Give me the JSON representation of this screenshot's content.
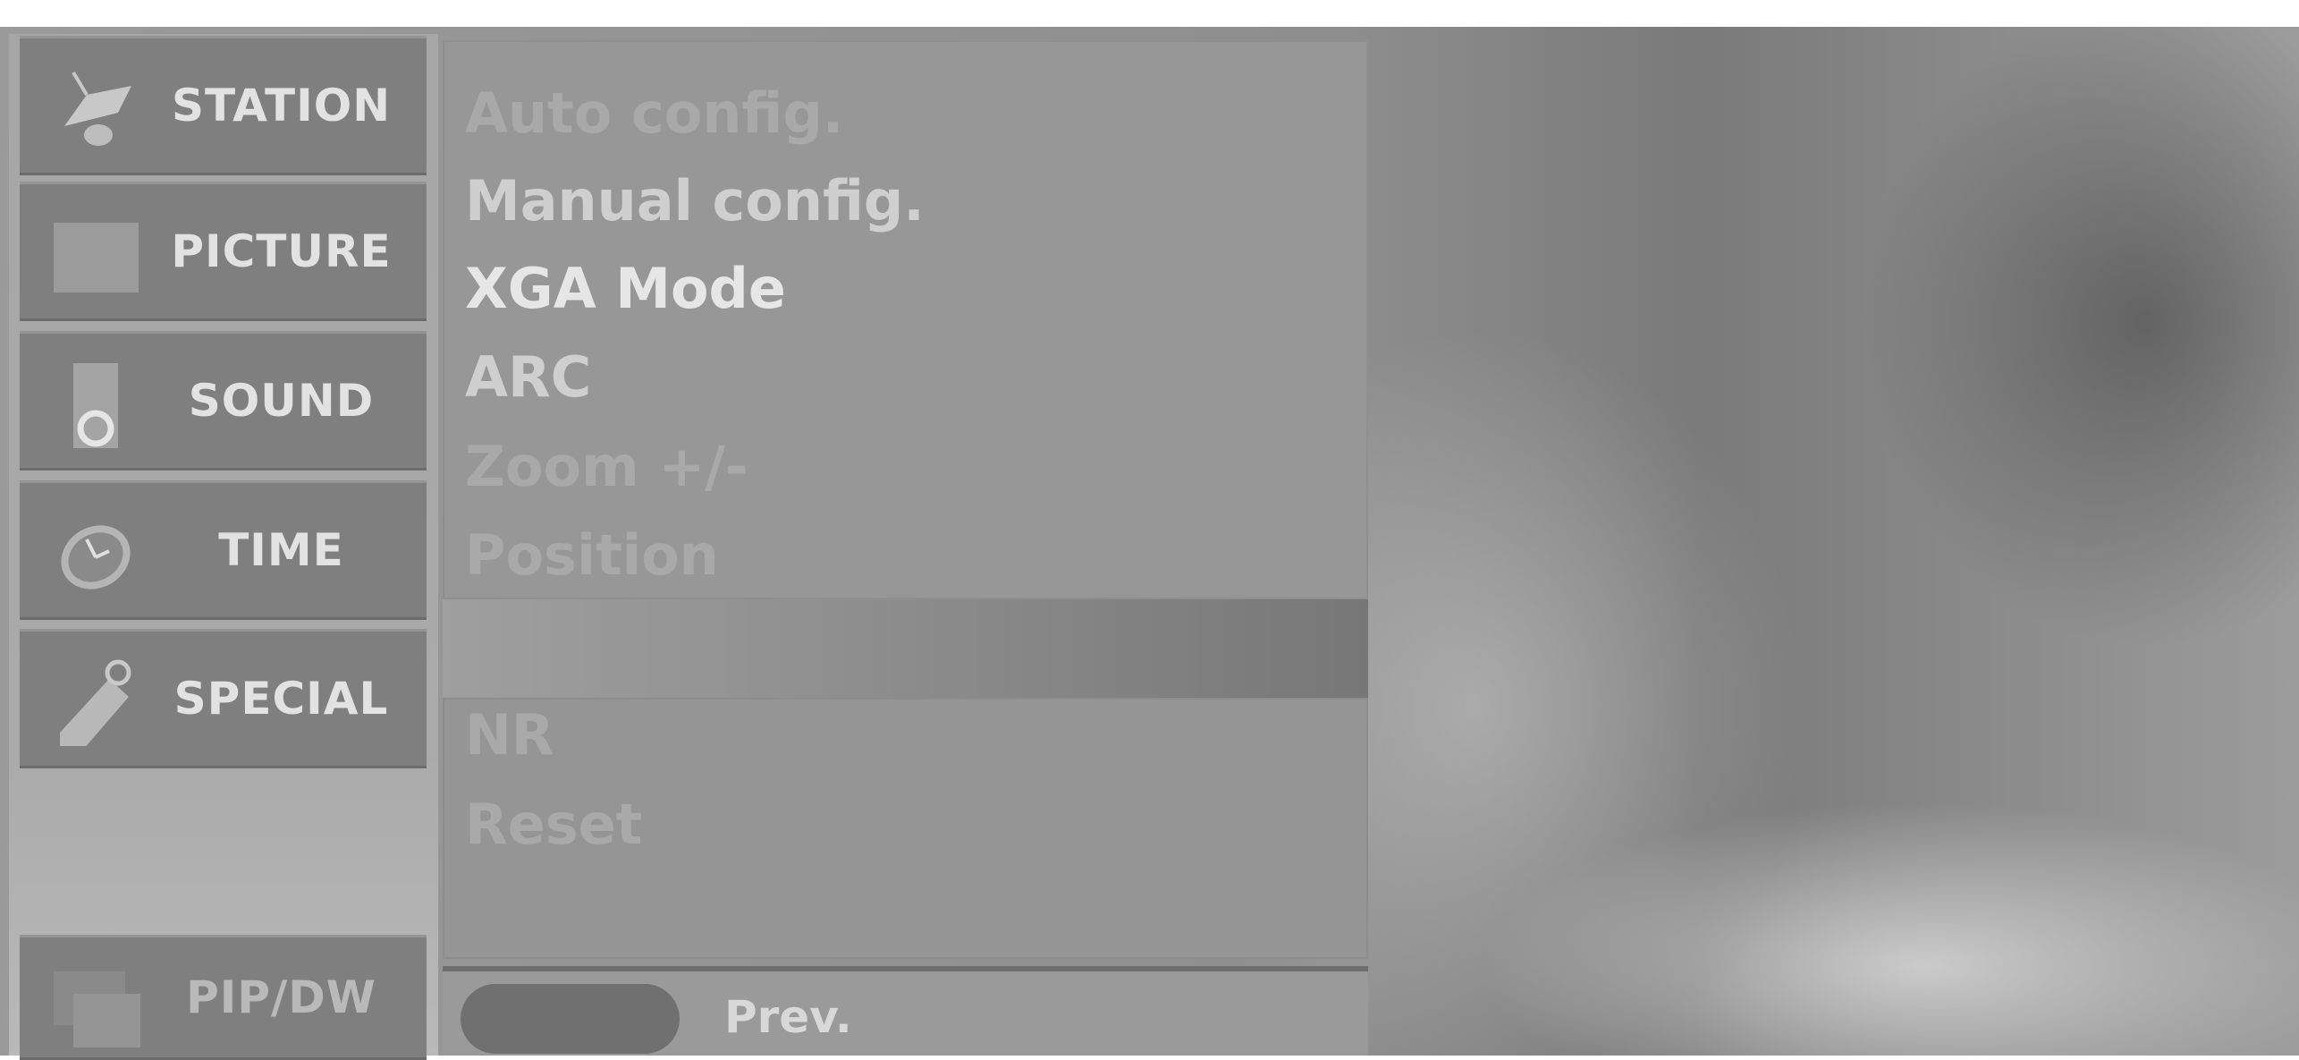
{
  "sidebar": {
    "items": [
      {
        "label": "STATION",
        "icon": "satellite-dish-icon"
      },
      {
        "label": "PICTURE",
        "icon": "picture-square-icon"
      },
      {
        "label": "SOUND",
        "icon": "speaker-icon"
      },
      {
        "label": "TIME",
        "icon": "clock-icon"
      },
      {
        "label": "SPECIAL",
        "icon": "tag-icon"
      }
    ],
    "bottom_item": {
      "label": "PIP/DW",
      "icon": "pip-window-icon"
    }
  },
  "menu": {
    "items": [
      {
        "label": "Auto config."
      },
      {
        "label": "Manual config."
      },
      {
        "label": "XGA Mode",
        "selected": true
      },
      {
        "label": "ARC"
      },
      {
        "label": "Zoom +/-"
      },
      {
        "label": "Position"
      }
    ],
    "lower_items": [
      {
        "label": "NR"
      },
      {
        "label": "Reset"
      }
    ]
  },
  "footer": {
    "prev_label": "Prev."
  }
}
